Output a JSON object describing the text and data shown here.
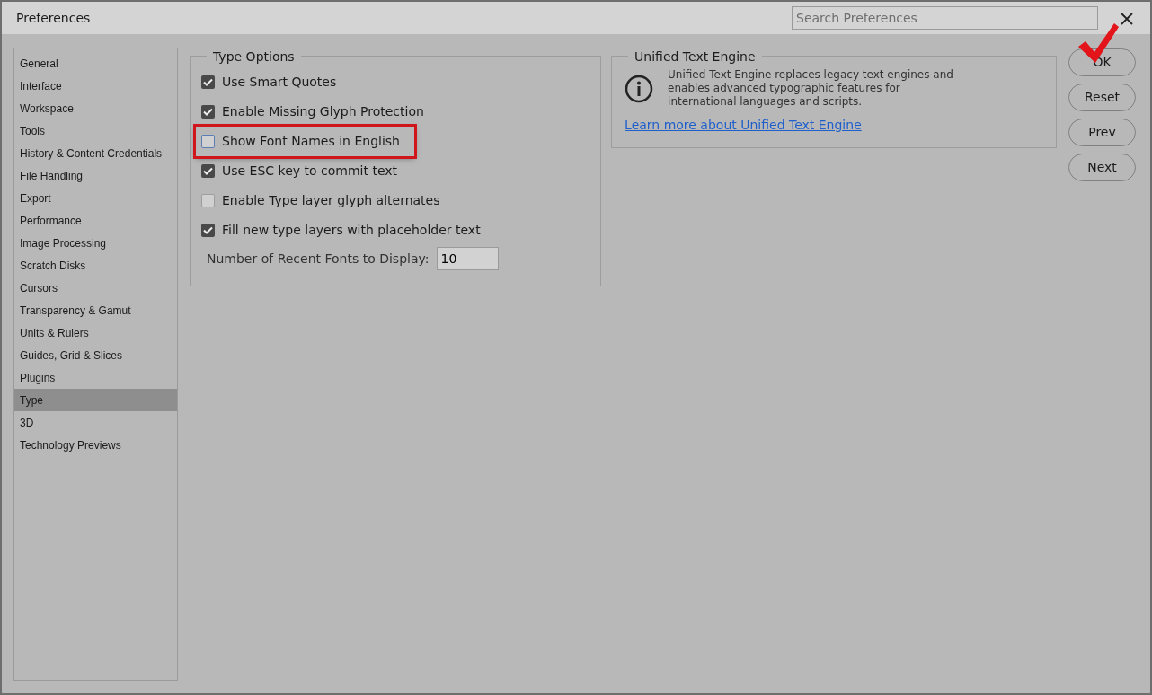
{
  "window": {
    "title": "Preferences"
  },
  "search": {
    "placeholder": "Search Preferences"
  },
  "sidebar": {
    "items": [
      {
        "label": "General",
        "selected": false
      },
      {
        "label": "Interface",
        "selected": false
      },
      {
        "label": "Workspace",
        "selected": false
      },
      {
        "label": "Tools",
        "selected": false
      },
      {
        "label": "History & Content Credentials",
        "selected": false
      },
      {
        "label": "File Handling",
        "selected": false
      },
      {
        "label": "Export",
        "selected": false
      },
      {
        "label": "Performance",
        "selected": false
      },
      {
        "label": "Image Processing",
        "selected": false
      },
      {
        "label": "Scratch Disks",
        "selected": false
      },
      {
        "label": "Cursors",
        "selected": false
      },
      {
        "label": "Transparency & Gamut",
        "selected": false
      },
      {
        "label": "Units & Rulers",
        "selected": false
      },
      {
        "label": "Guides, Grid & Slices",
        "selected": false
      },
      {
        "label": "Plugins",
        "selected": false
      },
      {
        "label": "Type",
        "selected": true
      },
      {
        "label": "3D",
        "selected": false
      },
      {
        "label": "Technology Previews",
        "selected": false
      }
    ]
  },
  "type_options": {
    "title": "Type Options",
    "options": [
      {
        "label": "Use Smart Quotes",
        "checked": true,
        "highlighted": false
      },
      {
        "label": "Enable Missing Glyph Protection",
        "checked": true,
        "highlighted": false
      },
      {
        "label": "Show Font Names in English",
        "checked": false,
        "highlighted": true
      },
      {
        "label": "Use ESC key to commit text",
        "checked": true,
        "highlighted": false
      },
      {
        "label": "Enable Type layer glyph alternates",
        "checked": false,
        "highlighted": false
      },
      {
        "label": "Fill new type layers with placeholder text",
        "checked": true,
        "highlighted": false
      }
    ],
    "recent_fonts": {
      "label": "Number of Recent Fonts to Display:",
      "value": "10"
    }
  },
  "unified_text_engine": {
    "title": "Unified Text Engine",
    "description": "Unified Text Engine replaces legacy text engines and enables advanced typographic features for international languages and scripts.",
    "link": "Learn more about Unified Text Engine"
  },
  "buttons": [
    {
      "label": "OK",
      "annotated": true
    },
    {
      "label": "Reset",
      "annotated": false
    },
    {
      "label": "Prev",
      "annotated": false
    },
    {
      "label": "Next",
      "annotated": false
    }
  ]
}
